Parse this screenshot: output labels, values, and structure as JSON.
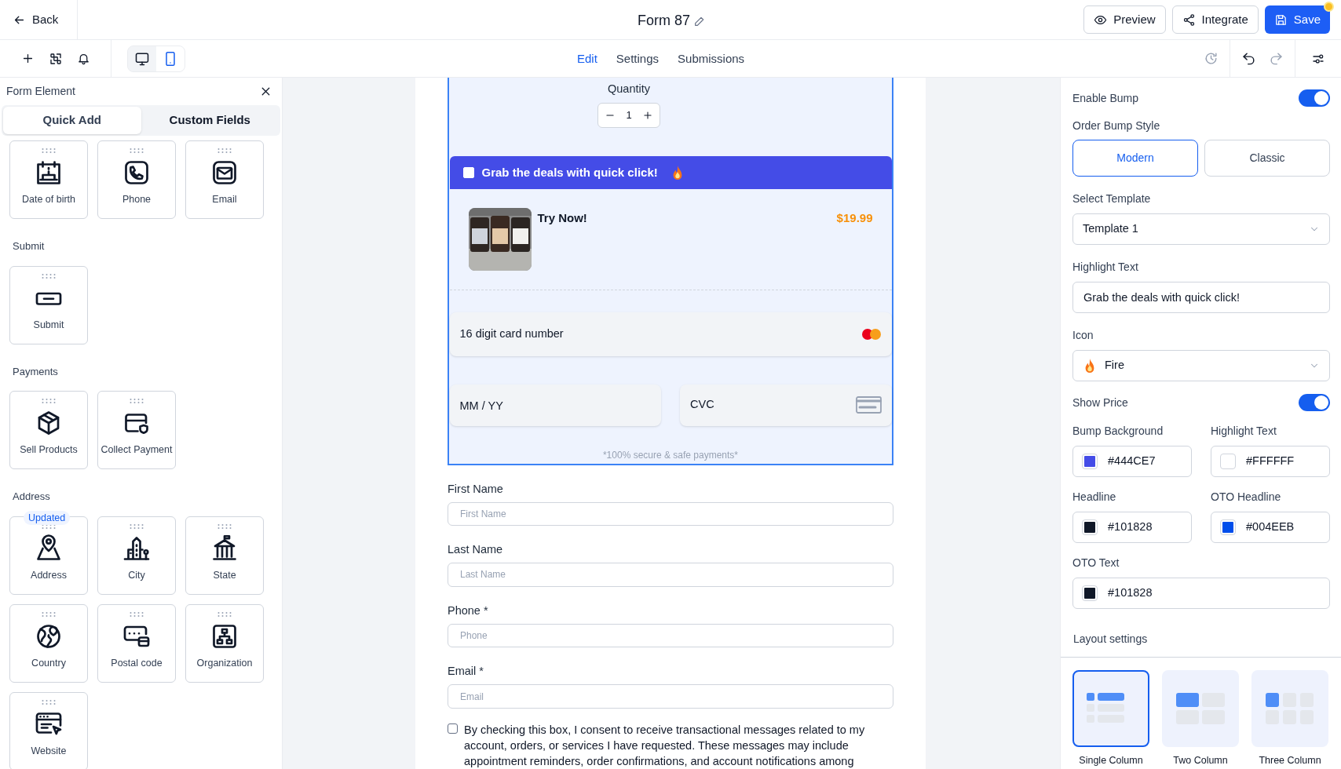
{
  "header": {
    "back": "Back",
    "title": "Form 87",
    "actions": [
      {
        "kind": "preview",
        "label": "Preview"
      },
      {
        "kind": "integrate",
        "label": "Integrate"
      },
      {
        "kind": "save",
        "label": "Save",
        "unsaved": true
      }
    ]
  },
  "toolbar": {
    "devices": [
      {
        "kind": "desktop",
        "selected": false
      },
      {
        "kind": "mobile",
        "selected": true
      }
    ],
    "tabs": [
      {
        "label": "Edit",
        "selected": true
      },
      {
        "label": "Settings",
        "selected": false
      },
      {
        "label": "Submissions",
        "selected": false
      }
    ],
    "redo_disabled": true
  },
  "left_panel": {
    "title": "Form Element",
    "tabs": [
      {
        "label": "Quick Add",
        "selected": true
      },
      {
        "label": "Custom Fields",
        "selected": false
      }
    ],
    "groups": [
      {
        "items": [
          {
            "kind": "birthday",
            "label": "Date of birth"
          },
          {
            "kind": "phone",
            "label": "Phone"
          },
          {
            "kind": "email",
            "label": "Email"
          }
        ]
      },
      {
        "title": "Submit",
        "items": [
          {
            "kind": "submit",
            "label": "Submit"
          }
        ]
      },
      {
        "title": "Payments",
        "items": [
          {
            "kind": "box",
            "label": "Sell Products"
          },
          {
            "kind": "card",
            "label": "Collect Payment"
          }
        ]
      },
      {
        "title": "Address",
        "items": [
          {
            "kind": "pin",
            "label": "Address",
            "badge": "Updated"
          },
          {
            "kind": "city",
            "label": "City"
          },
          {
            "kind": "state",
            "label": "State"
          },
          {
            "kind": "globe",
            "label": "Country"
          },
          {
            "kind": "postal",
            "label": "Postal code"
          },
          {
            "kind": "org",
            "label": "Organization"
          },
          {
            "kind": "website",
            "label": "Website"
          }
        ]
      }
    ]
  },
  "form": {
    "quantity": {
      "label": "Quantity",
      "value": "1"
    },
    "bump": {
      "checked": false,
      "headline": "Grab the deals with quick click!",
      "color": "#444ce7",
      "product": {
        "title": "Try Now!",
        "price": "$19.99"
      }
    },
    "payment": {
      "card_number": "16 digit card number",
      "expiry": "MM / YY",
      "cvc": "CVC",
      "note": "*100% secure & safe payments*"
    },
    "fields": [
      {
        "label": "First Name",
        "placeholder": "First Name"
      },
      {
        "label": "Last Name",
        "placeholder": "Last Name"
      },
      {
        "label": "Phone *",
        "placeholder": "Phone"
      },
      {
        "label": "Email *",
        "placeholder": "Email"
      }
    ],
    "consent": {
      "checked": false,
      "text": "By checking this box, I consent to receive transactional messages related to my account, orders, or services I have requested. These messages may include appointment reminders, order confirmations, and account notifications among"
    }
  },
  "right_panel": {
    "enable_bump": {
      "label": "Enable Bump",
      "on": true
    },
    "style": {
      "label": "Order Bump Style",
      "options": [
        {
          "label": "Modern",
          "selected": true
        },
        {
          "label": "Classic",
          "selected": false
        }
      ]
    },
    "template": {
      "label": "Select Template",
      "value": "Template 1"
    },
    "highlight_text": {
      "label": "Highlight Text",
      "value": "Grab the deals with quick click!"
    },
    "icon": {
      "label": "Icon",
      "value": "Fire"
    },
    "show_price": {
      "label": "Show Price",
      "on": true
    },
    "colors": [
      {
        "label": "Bump Background",
        "value": "#444CE7",
        "color": "#444ce7"
      },
      {
        "label": "Highlight Text",
        "value": "#FFFFFF",
        "color": "#ffffff"
      },
      {
        "label": "Headline",
        "value": "#101828",
        "color": "#101828"
      },
      {
        "label": "OTO Headline",
        "value": "#004EEB",
        "color": "#004eeb"
      },
      {
        "label": "OTO Text",
        "value": "#101828",
        "color": "#101828"
      }
    ],
    "layout": {
      "label": "Layout settings",
      "options": [
        {
          "kind": "single",
          "label": "Single Column",
          "selected": true
        },
        {
          "kind": "two",
          "label": "Two Column",
          "selected": false
        },
        {
          "kind": "three",
          "label": "Three Column",
          "selected": false
        }
      ]
    }
  }
}
